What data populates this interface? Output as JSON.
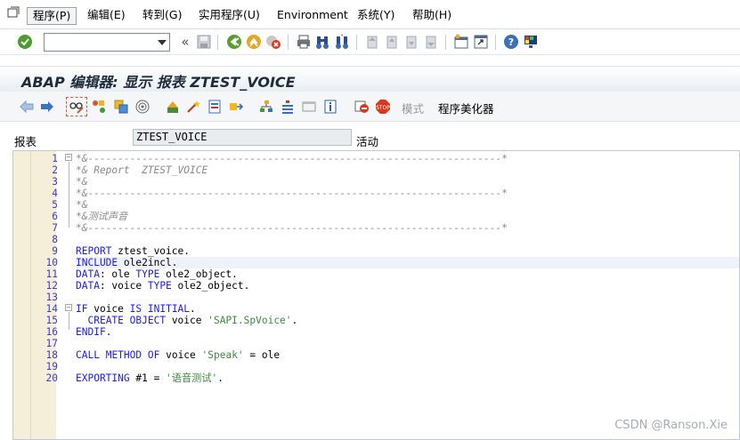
{
  "menubar": {
    "items": [
      {
        "label": "程序(P)"
      },
      {
        "label": "编辑(E)"
      },
      {
        "label": "转到(G)"
      },
      {
        "label": "实用程序(U)"
      },
      {
        "label": "Environment"
      },
      {
        "label": "系统(Y)"
      },
      {
        "label": "帮助(H)"
      }
    ]
  },
  "command_field": {
    "value": "",
    "placeholder": ""
  },
  "title": "ABAP 编辑器: 显示 报表 ZTEST_VOICE",
  "toolbar2": {
    "mode_label": "模式",
    "pretty_printer_label": "程序美化器"
  },
  "program": {
    "label": "报表",
    "name": "ZTEST_VOICE",
    "status": "活动"
  },
  "code_lines": [
    {
      "n": "1",
      "text": "*&---------------------------------------------------------------------*",
      "type": "comment"
    },
    {
      "n": "2",
      "text": "*& Report  ZTEST_VOICE",
      "type": "comment"
    },
    {
      "n": "3",
      "text": "*&",
      "type": "comment"
    },
    {
      "n": "4",
      "text": "*&---------------------------------------------------------------------*",
      "type": "comment"
    },
    {
      "n": "5",
      "text": "*&",
      "type": "comment"
    },
    {
      "n": "6",
      "text": "*&测试声音",
      "type": "comment"
    },
    {
      "n": "7",
      "text": "*&---------------------------------------------------------------------*",
      "type": "comment"
    },
    {
      "n": "8",
      "text": "",
      "type": "blank"
    },
    {
      "n": "9",
      "text": "REPORT ztest_voice.",
      "type": "code"
    },
    {
      "n": "10",
      "text": "INCLUDE ole2incl.",
      "type": "code"
    },
    {
      "n": "11",
      "text": "DATA: ole TYPE ole2_object.",
      "type": "code"
    },
    {
      "n": "12",
      "text": "DATA: voice TYPE ole2_object.",
      "type": "code"
    },
    {
      "n": "13",
      "text": "",
      "type": "blank"
    },
    {
      "n": "14",
      "text": "IF voice IS INITIAL.",
      "type": "code"
    },
    {
      "n": "15",
      "text": "  CREATE OBJECT voice 'SAPI.SpVoice'.",
      "type": "code"
    },
    {
      "n": "16",
      "text": "ENDIF.",
      "type": "code"
    },
    {
      "n": "17",
      "text": "",
      "type": "blank"
    },
    {
      "n": "18",
      "text": "CALL METHOD OF voice 'Speak' = ole",
      "type": "code"
    },
    {
      "n": "19",
      "text": "",
      "type": "blank"
    },
    {
      "n": "20",
      "text": "EXPORTING #1 = '语音测试'.",
      "type": "code"
    }
  ],
  "watermark": "CSDN @Ranson.Xie",
  "colors": {
    "keyword": "#1a1aff",
    "string": "#3c8a3c",
    "comment": "#8a8a8a",
    "line_number": "#3b3bd6",
    "gutter": "#f5efd9"
  }
}
